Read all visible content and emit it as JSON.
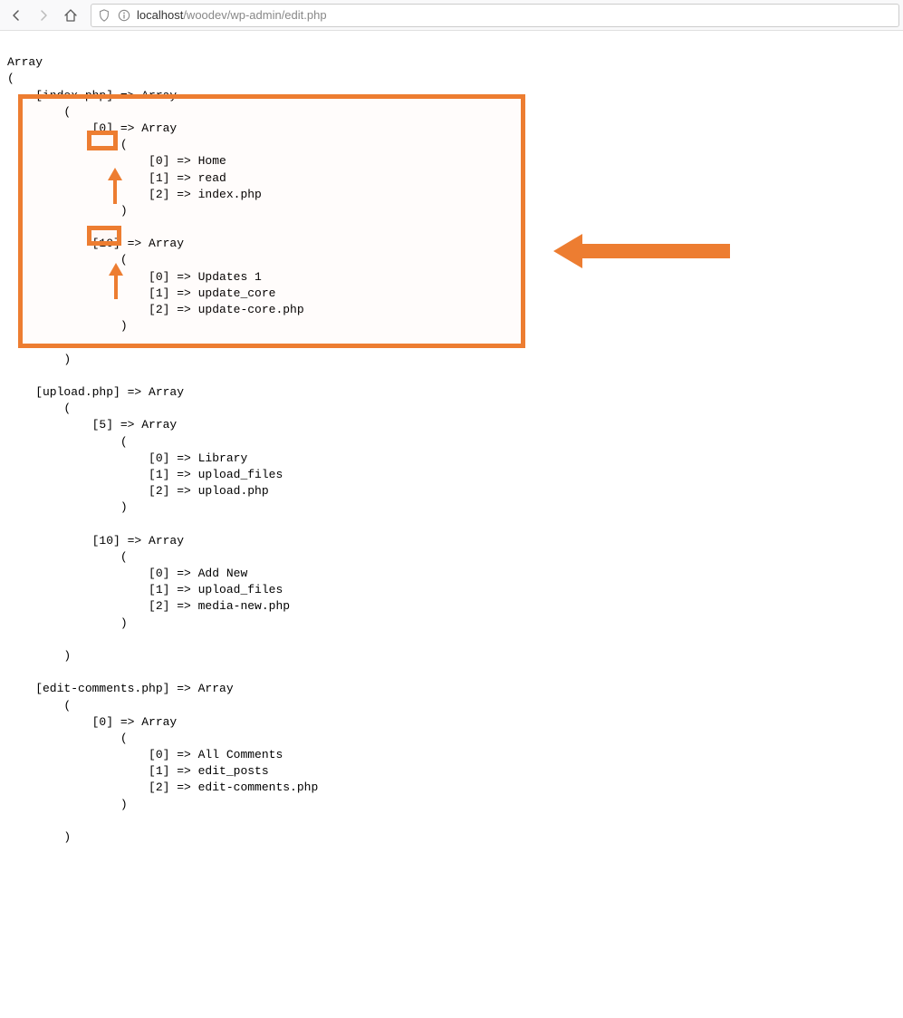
{
  "browser": {
    "url_host": "localhost",
    "url_path": "/woodev/wp-admin/edit.php"
  },
  "dump": {
    "root_label": "Array",
    "sections": [
      {
        "key": "index.php",
        "items": [
          {
            "idx": "0",
            "vals": [
              "Home",
              "read",
              "index.php"
            ]
          },
          {
            "idx": "10",
            "vals": [
              "Updates 1",
              "update_core",
              "update-core.php"
            ]
          }
        ]
      },
      {
        "key": "upload.php",
        "items": [
          {
            "idx": "5",
            "vals": [
              "Library",
              "upload_files",
              "upload.php"
            ]
          },
          {
            "idx": "10",
            "vals": [
              "Add New",
              "upload_files",
              "media-new.php"
            ]
          }
        ]
      },
      {
        "key": "edit-comments.php",
        "items": [
          {
            "idx": "0",
            "vals": [
              "All Comments",
              "edit_posts",
              "edit-comments.php"
            ]
          }
        ]
      }
    ]
  },
  "arrow_word": "Array",
  "open_paren": "(",
  "close_paren": ")",
  "arrow_sym": "=>"
}
